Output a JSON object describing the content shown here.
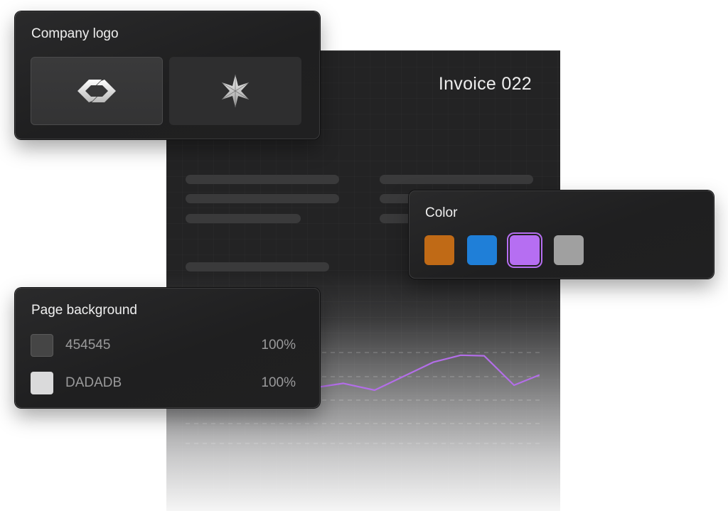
{
  "invoice": {
    "title": "Invoice 022",
    "trend_values": [
      0.22,
      0.28,
      0.17,
      0.62,
      0.73,
      0.72,
      0.25,
      0.41
    ]
  },
  "company_logo": {
    "title": "Company logo",
    "options": [
      {
        "icon": "linked-chevrons-logo-icon",
        "selected": true
      },
      {
        "icon": "six-point-star-logo-icon",
        "selected": false
      }
    ]
  },
  "color": {
    "title": "Color",
    "swatches": [
      {
        "hex": "#c06a16",
        "selected": false
      },
      {
        "hex": "#1f7fd8",
        "selected": false
      },
      {
        "hex": "#b66ef2",
        "selected": true
      },
      {
        "hex": "#a0a0a0",
        "selected": false
      }
    ]
  },
  "page_background": {
    "title": "Page background",
    "rows": [
      {
        "hex": "454545",
        "opacity": "100%",
        "swatch": "#454545"
      },
      {
        "hex": "DADADB",
        "opacity": "100%",
        "swatch": "#dadadb"
      }
    ]
  },
  "colors": {
    "accent": "#b66ef2",
    "panel": "#1f1f20",
    "document": "#232324"
  }
}
